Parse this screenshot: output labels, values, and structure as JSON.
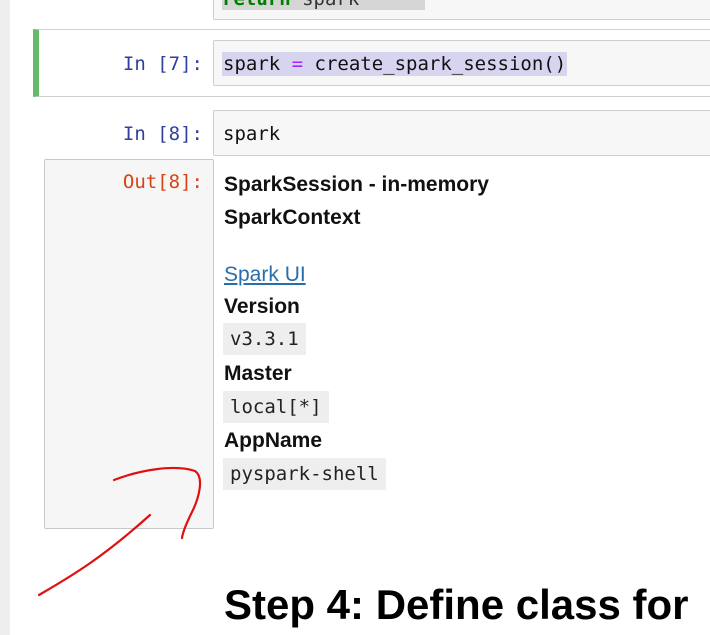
{
  "top_cell": {
    "code_keyword": "return",
    "code_rest": " spark"
  },
  "cell7": {
    "prompt": "In [7]:",
    "code": {
      "lhs": "spark ",
      "op": "=",
      "rhs": " create_spark_session()"
    }
  },
  "cell8": {
    "prompt_in": "In [8]:",
    "code": "spark",
    "prompt_out": "Out[8]:"
  },
  "output": {
    "session_title": "SparkSession - in-memory",
    "context_title": "SparkContext",
    "ui_link": "Spark UI",
    "version_label": "Version",
    "version_value": "v3.3.1",
    "master_label": "Master",
    "master_value": "local[*]",
    "appname_label": "AppName",
    "appname_value": "pyspark-shell"
  },
  "heading": "Step 4: Define class for",
  "colors": {
    "selected_cell_bar": "#66bb6a",
    "in_prompt": "#303f9f",
    "out_prompt": "#d84315",
    "selection_highlight": "#d7d4f0",
    "annotation_stroke": "#e01010"
  }
}
